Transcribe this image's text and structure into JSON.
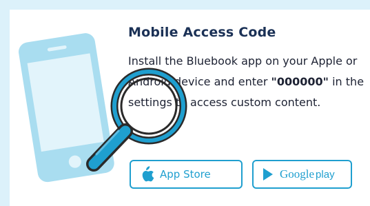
{
  "card": {
    "title": "Mobile Access Code",
    "description_pre": "Install the Bluebook app on your Apple or Android device and enter ",
    "code": "\"000000\"",
    "description_post": " in the settings to access custom content."
  },
  "buttons": {
    "app_store": {
      "label": "App Store",
      "icon": "apple-icon"
    },
    "google_play": {
      "label_brand": "Google",
      "label_suffix": "play",
      "icon": "play-icon"
    }
  },
  "colors": {
    "background": "#dcf1fa",
    "title": "#1b3156",
    "accent": "#1f9fcf",
    "phone_art": "#a9ddf0"
  }
}
